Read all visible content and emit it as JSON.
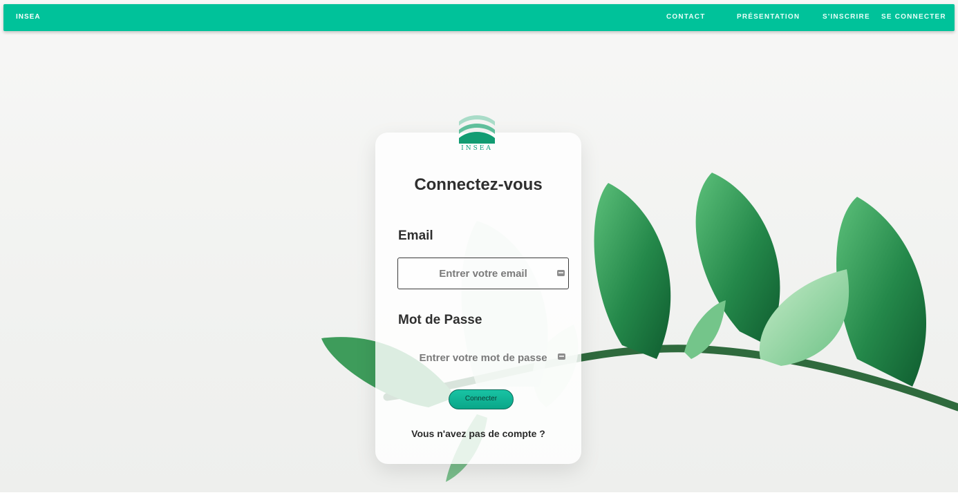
{
  "navbar": {
    "brand": "INSEA",
    "links": [
      "CONTACT",
      "PRÉSENTATION",
      "S'INSCRIRE",
      "SE CONNECTER"
    ]
  },
  "logo": {
    "text": "INSEA"
  },
  "login": {
    "title": "Connectez-vous",
    "email_label": "Email",
    "email_placeholder": "Entrer votre email",
    "password_label": "Mot de Passe",
    "password_placeholder": "Entrer votre mot de passe",
    "submit_label": "Connecter",
    "signup_link": "Vous n'avez pas de compte ?"
  },
  "colors": {
    "navbar": "#00c29a",
    "button": "#0aa688",
    "leaf": "#2e9e55"
  },
  "icons": [
    "insea-logo",
    "email-field-icon",
    "password-field-icon"
  ]
}
